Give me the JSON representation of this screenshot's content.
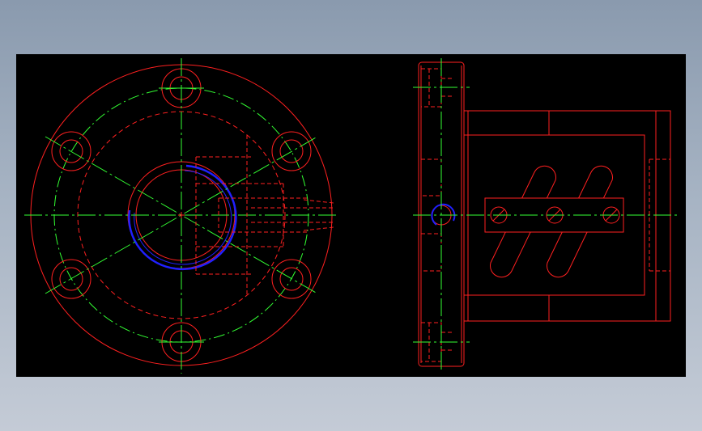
{
  "viewer": {
    "background_color": "#000000",
    "page_gradient": [
      "#8a9aae",
      "#c4cbd6"
    ]
  },
  "drawing": {
    "colors": {
      "outline": "#ff2020",
      "dashed": "#ff2020",
      "center_line": "#33ff33",
      "highlight": "#2020ff"
    },
    "views": [
      "front-view-flange",
      "side-view-assembly"
    ]
  }
}
